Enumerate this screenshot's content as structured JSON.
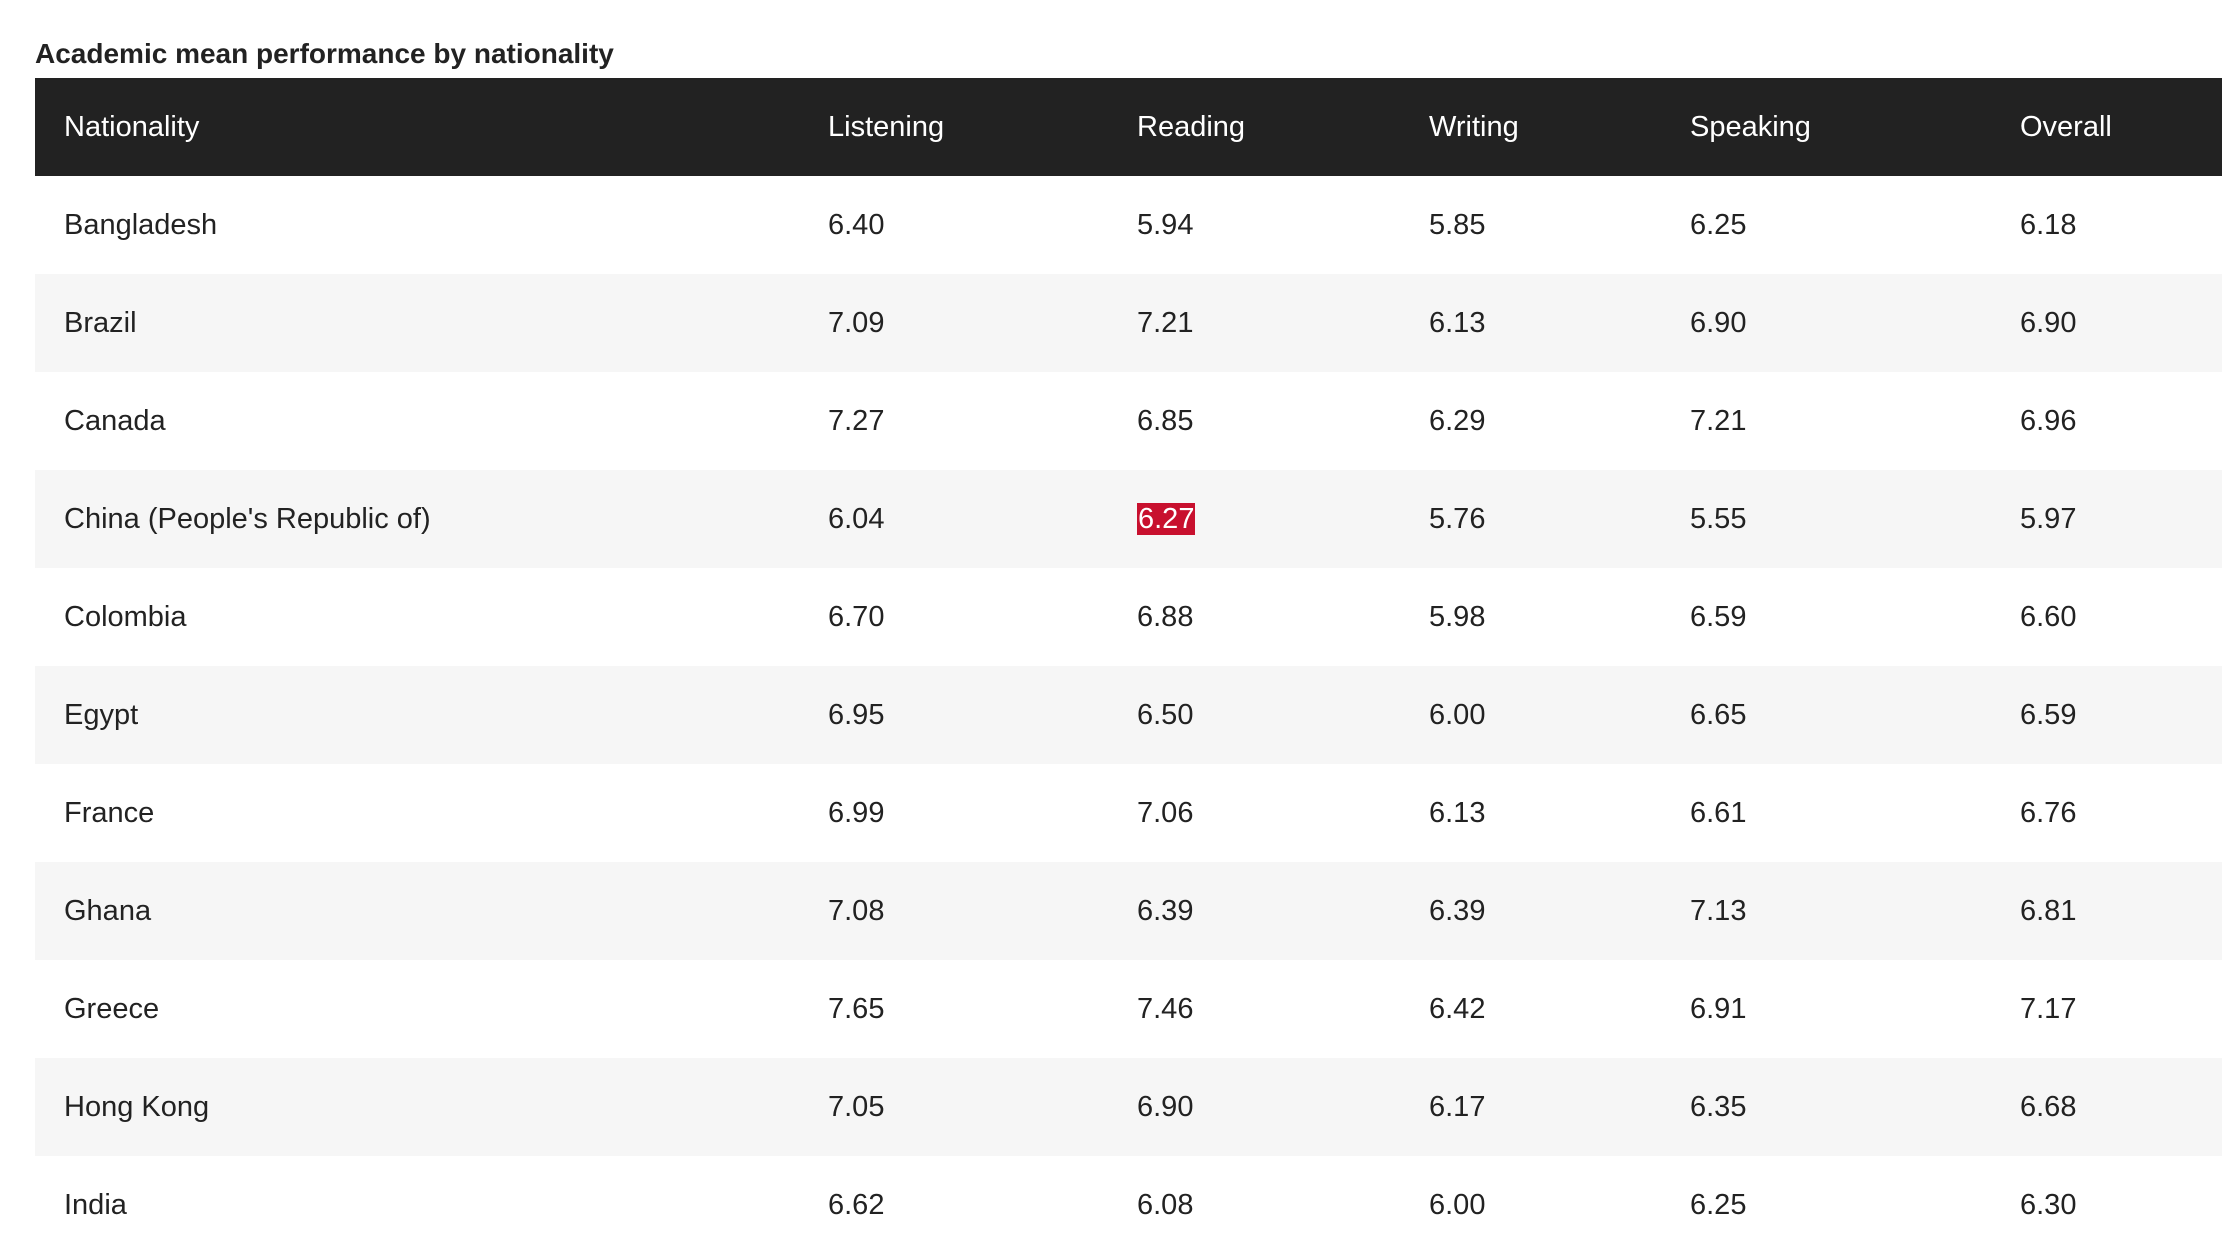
{
  "caption": "Academic mean performance by nationality",
  "highlight_color": "#c8102e",
  "header_color": "#222222",
  "columns": [
    "Nationality",
    "Listening",
    "Reading",
    "Writing",
    "Speaking",
    "Overall"
  ],
  "rows": [
    {
      "nationality": "Bangladesh",
      "listening": "6.40",
      "reading": "5.94",
      "writing": "5.85",
      "speaking": "6.25",
      "overall": "6.18"
    },
    {
      "nationality": "Brazil",
      "listening": "7.09",
      "reading": "7.21",
      "writing": "6.13",
      "speaking": "6.90",
      "overall": "6.90"
    },
    {
      "nationality": "Canada",
      "listening": "7.27",
      "reading": "6.85",
      "writing": "6.29",
      "speaking": "7.21",
      "overall": "6.96"
    },
    {
      "nationality": "China (People's Republic of)",
      "listening": "6.04",
      "reading": "6.27",
      "writing": "5.76",
      "speaking": "5.55",
      "overall": "5.97",
      "highlight": "reading"
    },
    {
      "nationality": "Colombia",
      "listening": "6.70",
      "reading": "6.88",
      "writing": "5.98",
      "speaking": "6.59",
      "overall": "6.60"
    },
    {
      "nationality": "Egypt",
      "listening": "6.95",
      "reading": "6.50",
      "writing": "6.00",
      "speaking": "6.65",
      "overall": "6.59"
    },
    {
      "nationality": "France",
      "listening": "6.99",
      "reading": "7.06",
      "writing": "6.13",
      "speaking": "6.61",
      "overall": "6.76"
    },
    {
      "nationality": "Ghana",
      "listening": "7.08",
      "reading": "6.39",
      "writing": "6.39",
      "speaking": "7.13",
      "overall": "6.81"
    },
    {
      "nationality": "Greece",
      "listening": "7.65",
      "reading": "7.46",
      "writing": "6.42",
      "speaking": "6.91",
      "overall": "7.17"
    },
    {
      "nationality": "Hong Kong",
      "listening": "7.05",
      "reading": "6.90",
      "writing": "6.17",
      "speaking": "6.35",
      "overall": "6.68"
    },
    {
      "nationality": "India",
      "listening": "6.62",
      "reading": "6.08",
      "writing": "6.00",
      "speaking": "6.25",
      "overall": "6.30"
    }
  ]
}
